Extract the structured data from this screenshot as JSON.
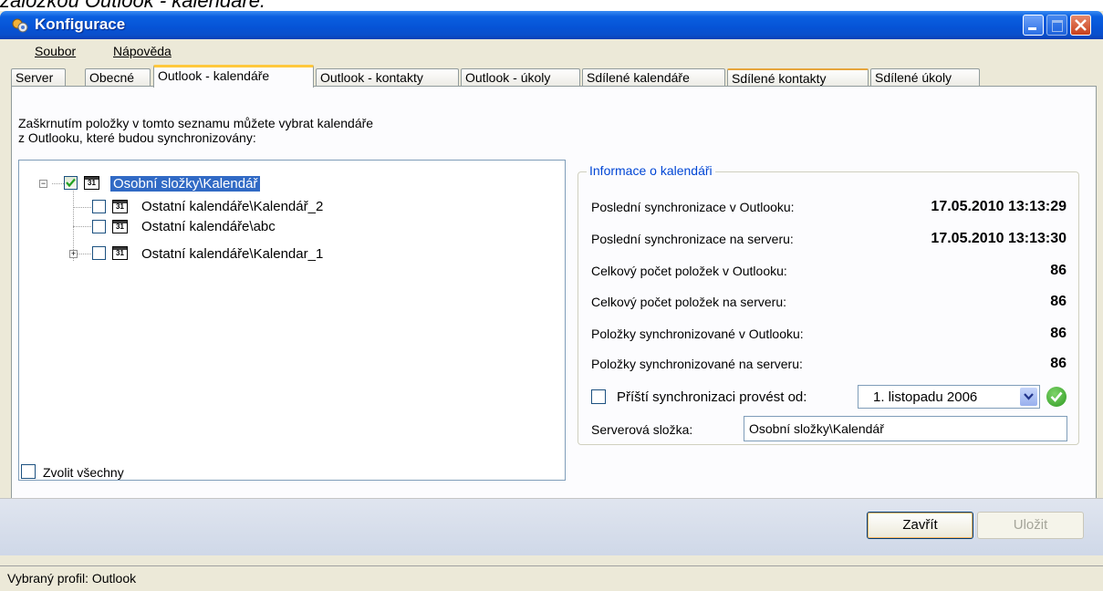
{
  "caption": "záložkou Outlook - kalendáře.",
  "window": {
    "title": "Konfigurace"
  },
  "menu": {
    "items": [
      {
        "label": "Soubor"
      },
      {
        "label": "Nápověda"
      }
    ]
  },
  "tabs": [
    {
      "label": "Server"
    },
    {
      "label": "Obecné"
    },
    {
      "label": "Outlook - kalendáře",
      "active": true
    },
    {
      "label": "Outlook - kontakty"
    },
    {
      "label": "Outlook - úkoly"
    },
    {
      "label": "Sdílené kalendáře"
    },
    {
      "label": "Sdílené kontakty"
    },
    {
      "label": "Sdílené úkoly"
    }
  ],
  "instructions": {
    "line1": "Zaškrnutím položky v tomto seznamu můžete vybrat kalendáře",
    "line2": "z Outlooku, které budou synchronizovány:"
  },
  "tree": {
    "nodes": [
      {
        "label": "Osobní složky\\Kalendář",
        "checked": true,
        "selected": true,
        "icon": "calendar-icon",
        "icon_text": "31"
      },
      {
        "label": "Ostatní kalendáře\\Kalendář_2",
        "checked": false,
        "icon": "calendar-icon",
        "icon_text": "31"
      },
      {
        "label": "Ostatní kalendáře\\abc",
        "checked": false,
        "icon": "calendar-icon",
        "icon_text": "31"
      },
      {
        "label": "Ostatní kalendáře\\Kalendar_1",
        "checked": false,
        "icon": "calendar-icon",
        "icon_text": "31"
      }
    ]
  },
  "info": {
    "title": "Informace o kalendáři",
    "rows": [
      {
        "label": "Poslední synchronizace v Outlooku:",
        "value": "17.05.2010 13:13:29"
      },
      {
        "label": "Poslední synchronizace na serveru:",
        "value": "17.05.2010 13:13:30"
      },
      {
        "label": "Celkový počet položek v Outlooku:",
        "value": "86"
      },
      {
        "label": "Celkový počet položek na serveru:",
        "value": "86"
      },
      {
        "label": "Položky synchronizované v Outlooku:",
        "value": "86"
      },
      {
        "label": "Položky synchronizované na serveru:",
        "value": "86"
      }
    ],
    "next_sync": {
      "label": "Příští synchronizaci provést od:",
      "checked": false,
      "date": "1. listopadu 2006"
    },
    "server_folder": {
      "label": "Serverová složka:",
      "value": "Osobní složky\\Kalendář"
    }
  },
  "select_all": {
    "label": "Zvolit všechny",
    "checked": false
  },
  "buttons": {
    "close": "Zavřít",
    "save": "Uložit"
  },
  "status": {
    "text": "Vybraný profil: Outlook"
  },
  "colors": {
    "titlebar": "#0653d6",
    "selection": "#316ac5",
    "group_title": "#0046d5",
    "active_tab_accent": "#ffc83c",
    "ok": "#2e9a22"
  }
}
